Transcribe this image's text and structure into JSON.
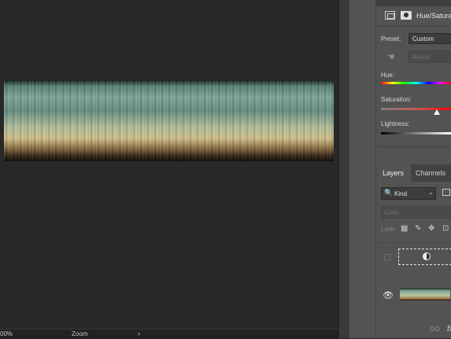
{
  "status": {
    "zoom": "00%",
    "mode": "Zoom",
    "arrow": "›"
  },
  "properties": {
    "title": "Hue/Saturatio",
    "preset_label": "Preset:",
    "preset_value": "Custom",
    "channel_value": "Master",
    "hue_label": "Hue:",
    "saturation_label": "Saturation:",
    "lightness_label": "Lightness:"
  },
  "layers": {
    "tabs": [
      "Layers",
      "Channels"
    ],
    "filter_value": "Kind",
    "blend_mode": "Color",
    "lock_label": "Lock:",
    "items": [
      {
        "type": "adjustment",
        "visible": false
      },
      {
        "type": "image",
        "visible": true
      }
    ],
    "footer": "GO",
    "footer_fx": "fx"
  },
  "icons": {
    "search": "🔍",
    "chevron": "⌄",
    "hand": "☚",
    "eye": "👁",
    "lock_pixels": "▦",
    "lock_brush": "✎",
    "lock_move": "✥",
    "lock_artboard": "⊡"
  },
  "colors": {
    "panel": "#535353",
    "canvas": "#282828",
    "accent": "#f0f0f0"
  }
}
